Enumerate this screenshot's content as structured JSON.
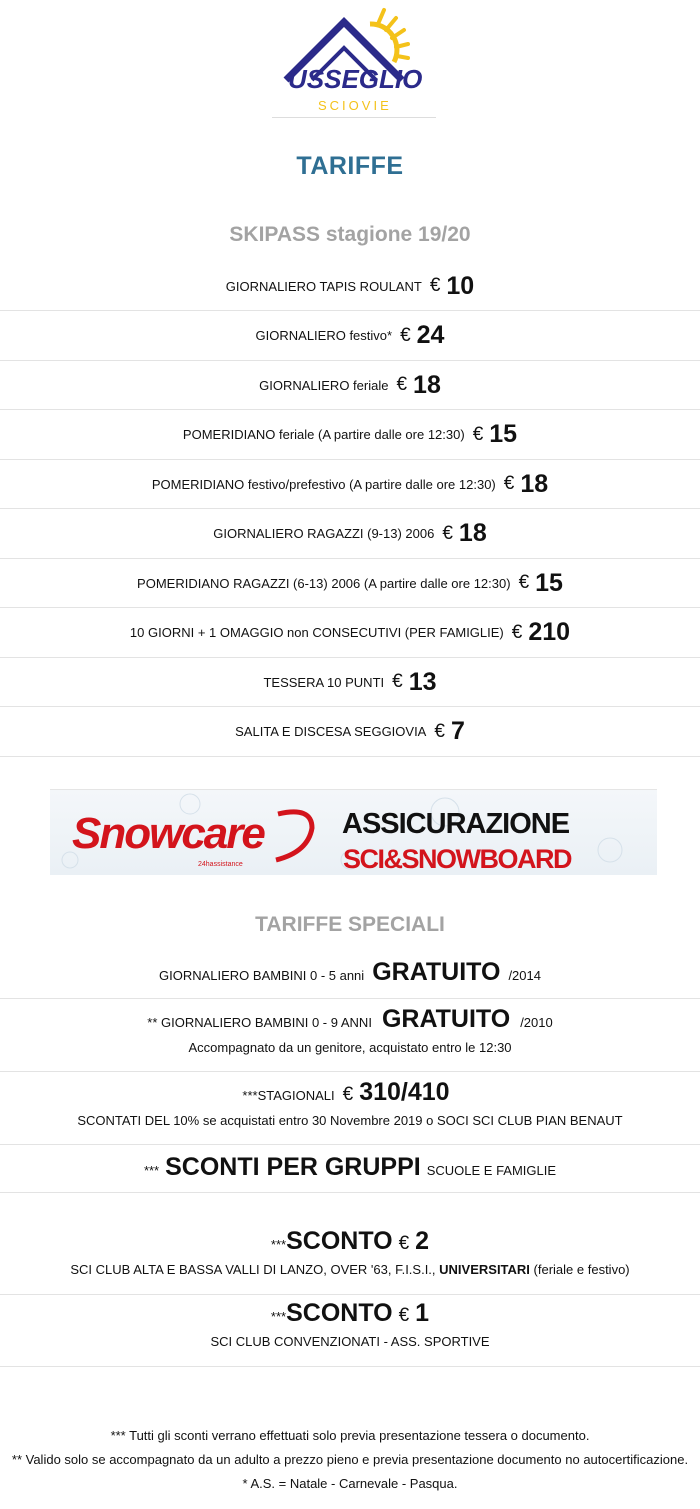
{
  "logo": {
    "brand": "USSEGLIO",
    "sub": "SCIOVIE"
  },
  "page_title": "TARIFFE",
  "skipass": {
    "title": "SKIPASS stagione 19/20",
    "currency": "€",
    "items": [
      {
        "label": "GIORNALIERO TAPIS ROULANT",
        "price": "10"
      },
      {
        "label": "GIORNALIERO festivo*",
        "price": "24"
      },
      {
        "label": "GIORNALIERO feriale",
        "price": "18"
      },
      {
        "label": "POMERIDIANO feriale (A partire dalle ore 12:30)",
        "price": "15"
      },
      {
        "label": "POMERIDIANO festivo/prefestivo (A partire dalle ore 12:30)",
        "price": "18"
      },
      {
        "label": "GIORNALIERO RAGAZZI (9-13) 2006",
        "price": "18"
      },
      {
        "label": "POMERIDIANO RAGAZZI (6-13) 2006 (A partire dalle ore 12:30)",
        "price": "15"
      },
      {
        "label": "10 GIORNI + 1 OMAGGIO non CONSECUTIVI (PER FAMIGLIE)",
        "price": "210"
      },
      {
        "label": "TESSERA 10 PUNTI",
        "price": "13"
      },
      {
        "label": "SALITA E DISCESA SEGGIOVIA",
        "price": "7"
      }
    ]
  },
  "banner": {
    "brand": "Snowcare",
    "tagline": "24hassistance",
    "line1": "ASSICURAZIONE",
    "line2": "SCI&SNOWBOARD"
  },
  "special": {
    "title": "TARIFFE SPECIALI",
    "bambini5": {
      "pre": "GIORNALIERO BAMBINI 0 - 5 anni",
      "big": "GRATUITO",
      "post": "/2014"
    },
    "bambini9": {
      "pre": "** GIORNALIERO BAMBINI 0 - 9 ANNI",
      "big": "GRATUITO",
      "post": "/2010",
      "sub": "Accompagnato da un genitore, acquistato entro le 12:30"
    },
    "stagionali": {
      "pre": "***STAGIONALI",
      "eur": "€",
      "big": "310/410",
      "sub": "SCONTATI DEL 10% se acquistati entro 30 Novembre 2019 o SOCI SCI CLUB PIAN BENAUT"
    },
    "gruppi": {
      "pre": "***",
      "big": "SCONTI PER GRUPPI",
      "post": "SCUOLE E FAMIGLIE"
    },
    "sconto2": {
      "pre": "***",
      "big": "SCONTO",
      "eur": "€",
      "amount": "2",
      "sub_a": "SCI CLUB ALTA E BASSA VALLI DI LANZO, OVER '63, F.I.S.I., ",
      "sub_b": "UNIVERSITARI",
      "sub_c": " (feriale e festivo)"
    },
    "sconto1": {
      "pre": "***",
      "big": "SCONTO",
      "eur": "€",
      "amount": "1",
      "sub": "SCI CLUB CONVENZIONATI - ASS. SPORTIVE"
    }
  },
  "footnotes": [
    "*** Tutti gli sconti verrano effettuati solo previa presentazione tessera o documento.",
    "** Valido solo se accompagnato da un adulto a prezzo pieno e previa presentazione documento no autocertificazione.",
    "* A.S. = Natale - Carnevale - Pasqua."
  ],
  "colors": {
    "title_blue": "#2f6f93",
    "section_grey": "#a3a3a3",
    "logo_navy": "#2b2a8a",
    "logo_sun": "#f4c21a",
    "snowcare_red": "#d3141c"
  }
}
